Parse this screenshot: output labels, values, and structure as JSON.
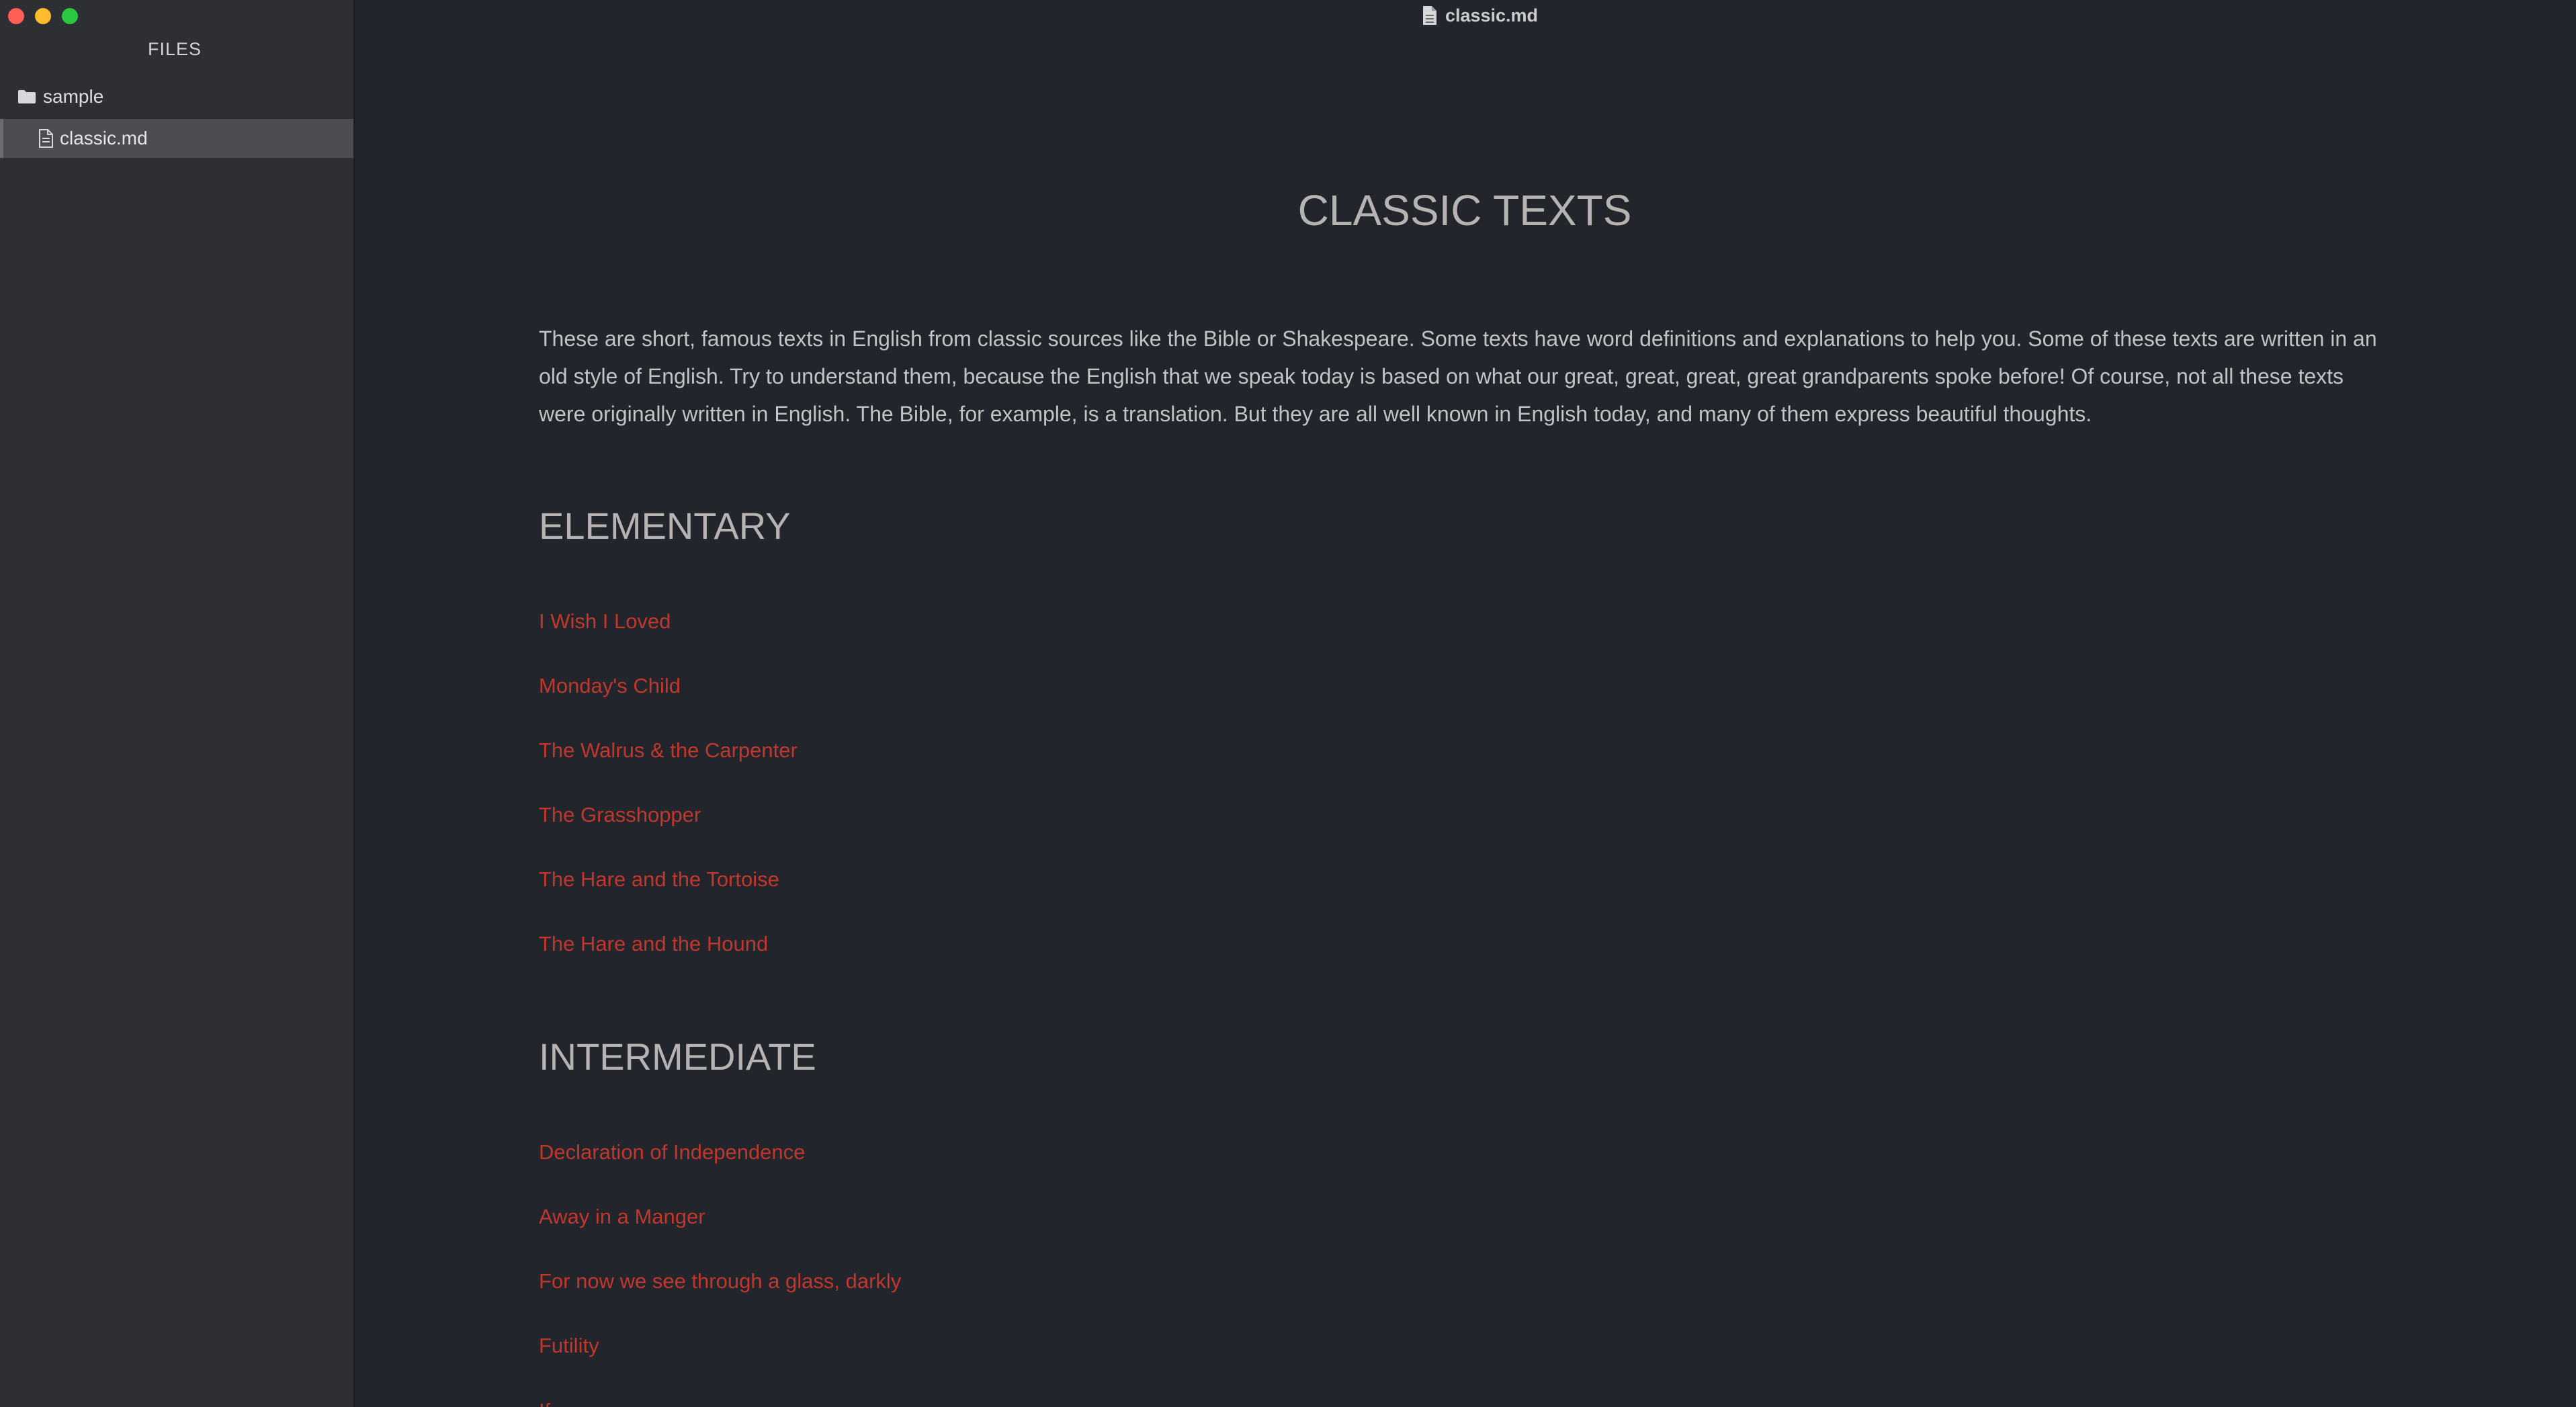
{
  "window": {
    "title": "classic.md"
  },
  "sidebar": {
    "header": "FILES",
    "folder": {
      "label": "sample",
      "icon": "folder-icon"
    },
    "file": {
      "label": "classic.md",
      "icon": "file-icon",
      "selected": true
    }
  },
  "document": {
    "title": "CLASSIC TEXTS",
    "intro": "These are short, famous texts in English from classic sources like the Bible or Shakespeare. Some texts have word definitions and explanations to help you. Some of these texts are written in an old style of English. Try to understand them, because the English that we speak today is based on what our great, great, great, great grandparents spoke before! Of course, not all these texts were originally written in English. The Bible, for example, is a translation. But they are all well known in English today, and many of them express beautiful thoughts.",
    "sections": [
      {
        "heading": "ELEMENTARY",
        "links": [
          "I Wish I Loved",
          "Monday's Child",
          "The Walrus & the Carpenter",
          "The Grasshopper",
          "The Hare and the Tortoise",
          "The Hare and the Hound"
        ]
      },
      {
        "heading": "INTERMEDIATE",
        "links": [
          "Declaration of Independence",
          "Away in a Manger",
          "For now we see through a glass, darkly",
          "Futility",
          "If"
        ]
      }
    ]
  },
  "colors": {
    "background": "#22252b",
    "sidebar": "#2d2f33",
    "selected_row": "#4b4d52",
    "heading": "#b6b3b3",
    "body_text": "#c2c3c6",
    "link": "#c2372c"
  }
}
